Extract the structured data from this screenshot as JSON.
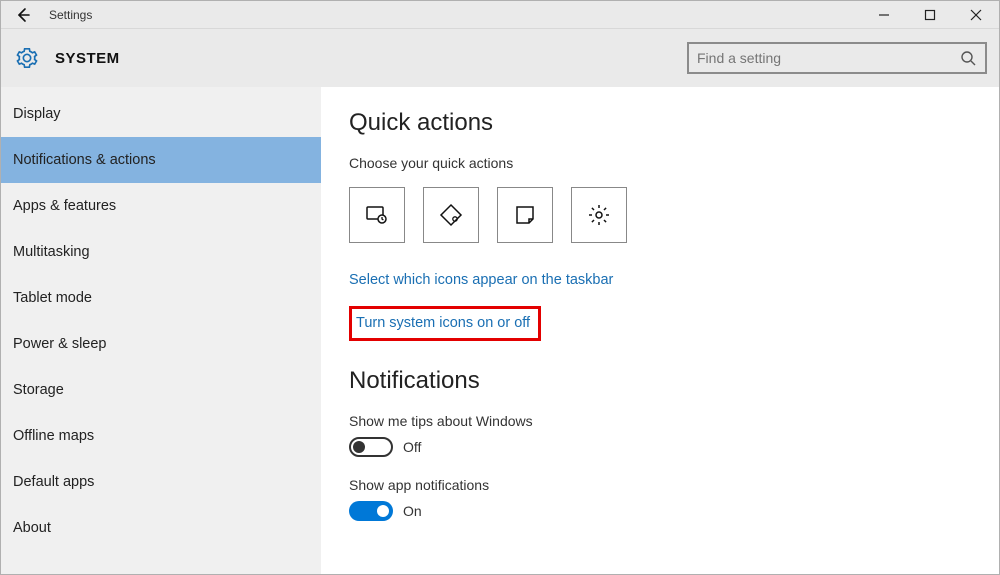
{
  "titlebar": {
    "title": "Settings"
  },
  "header": {
    "page_title": "SYSTEM",
    "search_placeholder": "Find a setting"
  },
  "sidebar": {
    "items": [
      {
        "label": "Display"
      },
      {
        "label": "Notifications & actions"
      },
      {
        "label": "Apps & features"
      },
      {
        "label": "Multitasking"
      },
      {
        "label": "Tablet mode"
      },
      {
        "label": "Power & sleep"
      },
      {
        "label": "Storage"
      },
      {
        "label": "Offline maps"
      },
      {
        "label": "Default apps"
      },
      {
        "label": "About"
      }
    ],
    "selected_index": 1
  },
  "content": {
    "quick_actions": {
      "heading": "Quick actions",
      "subtext": "Choose your quick actions",
      "tiles": [
        "tablet-mode-icon",
        "note-icon",
        "sticky-note-icon",
        "settings-gear-icon"
      ],
      "link_taskbar": "Select which icons appear on the taskbar",
      "link_system_icons": "Turn system icons on or off"
    },
    "notifications": {
      "heading": "Notifications",
      "items": [
        {
          "label": "Show me tips about Windows",
          "state": "off",
          "state_text": "Off"
        },
        {
          "label": "Show app notifications",
          "state": "on",
          "state_text": "On"
        }
      ]
    }
  }
}
